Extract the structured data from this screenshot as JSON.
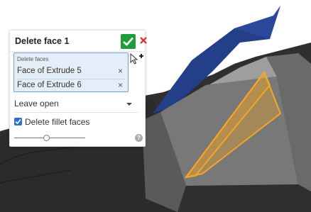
{
  "dialog": {
    "title": "Delete face 1",
    "faces_label": "Delete faces",
    "faces": [
      "Face of Extrude 5",
      "Face of Extrude 6"
    ],
    "remove_glyph": "×",
    "mode": "Leave open",
    "delete_fillet_label": "Delete fillet faces",
    "delete_fillet_checked": true,
    "slider_fraction": 0.45,
    "help_glyph": "?"
  },
  "icons": {
    "confirm": "checkmark-icon",
    "cancel": "close-x-icon",
    "help": "question-icon",
    "cursor": "pointer-add-cursor"
  },
  "colors": {
    "confirm_green": "#1f9d3a",
    "cancel_red": "#d93a2f",
    "selection_blue": "#e3eef9",
    "accent_blue": "#2a6fc9",
    "highlight_orange": "#f5a623"
  }
}
